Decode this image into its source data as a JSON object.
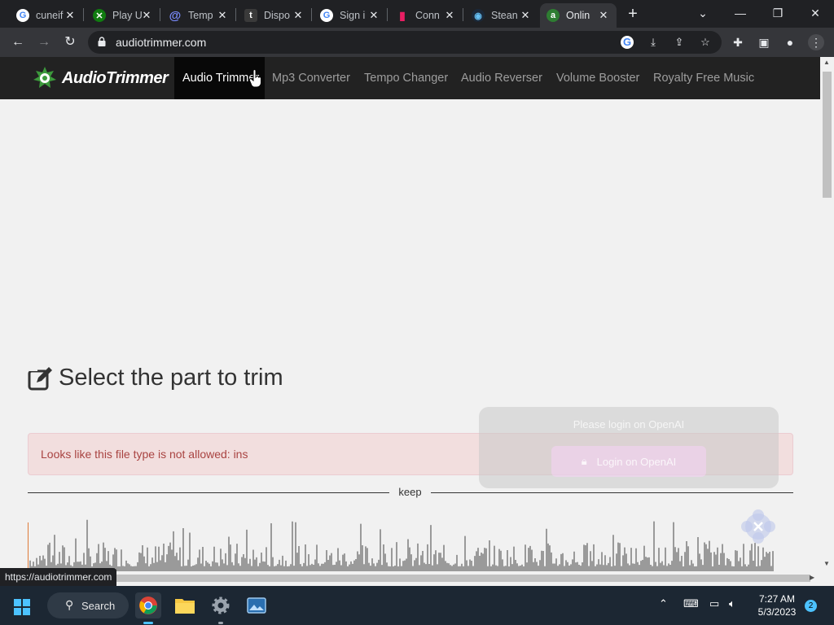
{
  "browser": {
    "tabs": [
      {
        "title": "cuneif",
        "icon": "google-icon",
        "color": "#ffffff"
      },
      {
        "title": "Play U",
        "icon": "xbox-icon",
        "color": "#107c10"
      },
      {
        "title": "Temp",
        "icon": "at-sign-icon",
        "color": "#7b8cff"
      },
      {
        "title": "Dispo",
        "icon": "t-icon",
        "color": "#555555"
      },
      {
        "title": "Sign i",
        "icon": "google-icon",
        "color": "#ffffff"
      },
      {
        "title": "Conn",
        "icon": "bookmark-icon",
        "color": "#e91e63"
      },
      {
        "title": "Stean",
        "icon": "steam-icon",
        "color": "#1b2838"
      },
      {
        "title": "Onlin",
        "icon": "audiotrimmer-icon",
        "color": "#4caf50"
      }
    ],
    "url": "audiotrimmer.com",
    "status_url": "https://audiotrimmer.com"
  },
  "site": {
    "logo_text": "AudioTrimmer",
    "nav": [
      {
        "label": "Audio Trimmer",
        "active": true
      },
      {
        "label": "Mp3 Converter"
      },
      {
        "label": "Tempo Changer"
      },
      {
        "label": "Audio Reverser"
      },
      {
        "label": "Volume Booster"
      },
      {
        "label": "Royalty Free Music"
      }
    ]
  },
  "main": {
    "heading": "Select the part to trim",
    "alert": "Looks like this file type is not allowed: ins",
    "keep_label": "keep"
  },
  "openai_overlay": {
    "message": "Please login on OpenAI",
    "button_label": "Login on OpenAI"
  },
  "taskbar": {
    "search_label": "Search",
    "time": "7:27 AM",
    "date": "5/3/2023",
    "notification_count": "2"
  }
}
